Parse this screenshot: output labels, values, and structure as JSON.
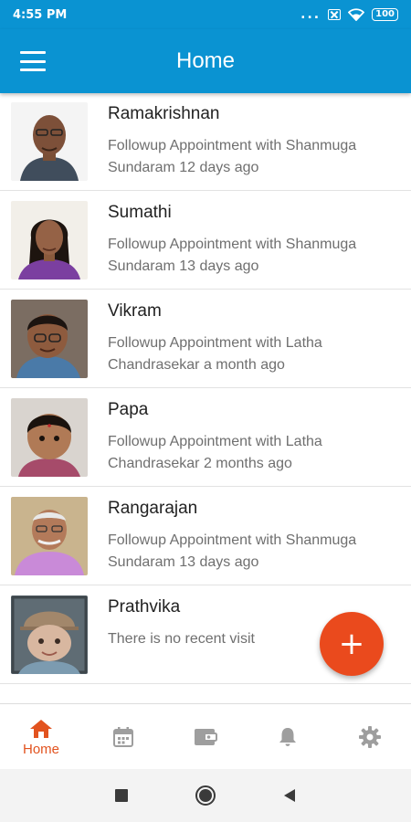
{
  "status_bar": {
    "time": "4:55 PM",
    "dots": "...",
    "battery": "100"
  },
  "app_bar": {
    "title": "Home",
    "menu_icon": "hamburger-menu-icon"
  },
  "patients": [
    {
      "name": "Ramakrishnan",
      "visit": "Followup Appointment with Shanmuga Sundaram 12 days ago"
    },
    {
      "name": "Sumathi",
      "visit": "Followup Appointment with Shanmuga Sundaram 13 days ago"
    },
    {
      "name": "Vikram",
      "visit": "Followup Appointment with Latha Chandrasekar a month ago"
    },
    {
      "name": "Papa",
      "visit": "Followup Appointment with Latha Chandrasekar 2 months ago"
    },
    {
      "name": "Rangarajan",
      "visit": "Followup Appointment with Shanmuga Sundaram 13 days ago"
    },
    {
      "name": "Prathvika",
      "visit": "There is no recent visit"
    }
  ],
  "fab": {
    "symbol": "+"
  },
  "bottom_nav": {
    "items": [
      {
        "label": "Home",
        "icon": "home-icon",
        "active": true
      },
      {
        "label": "",
        "icon": "calendar-icon",
        "active": false
      },
      {
        "label": "",
        "icon": "wallet-icon",
        "active": false
      },
      {
        "label": "",
        "icon": "bell-icon",
        "active": false
      },
      {
        "label": "",
        "icon": "gear-icon",
        "active": false
      }
    ]
  },
  "colors": {
    "primary": "#0a93d2",
    "accent": "#ea4a1d",
    "active_nav": "#e2531f",
    "inactive_nav": "#9e9e9e"
  }
}
